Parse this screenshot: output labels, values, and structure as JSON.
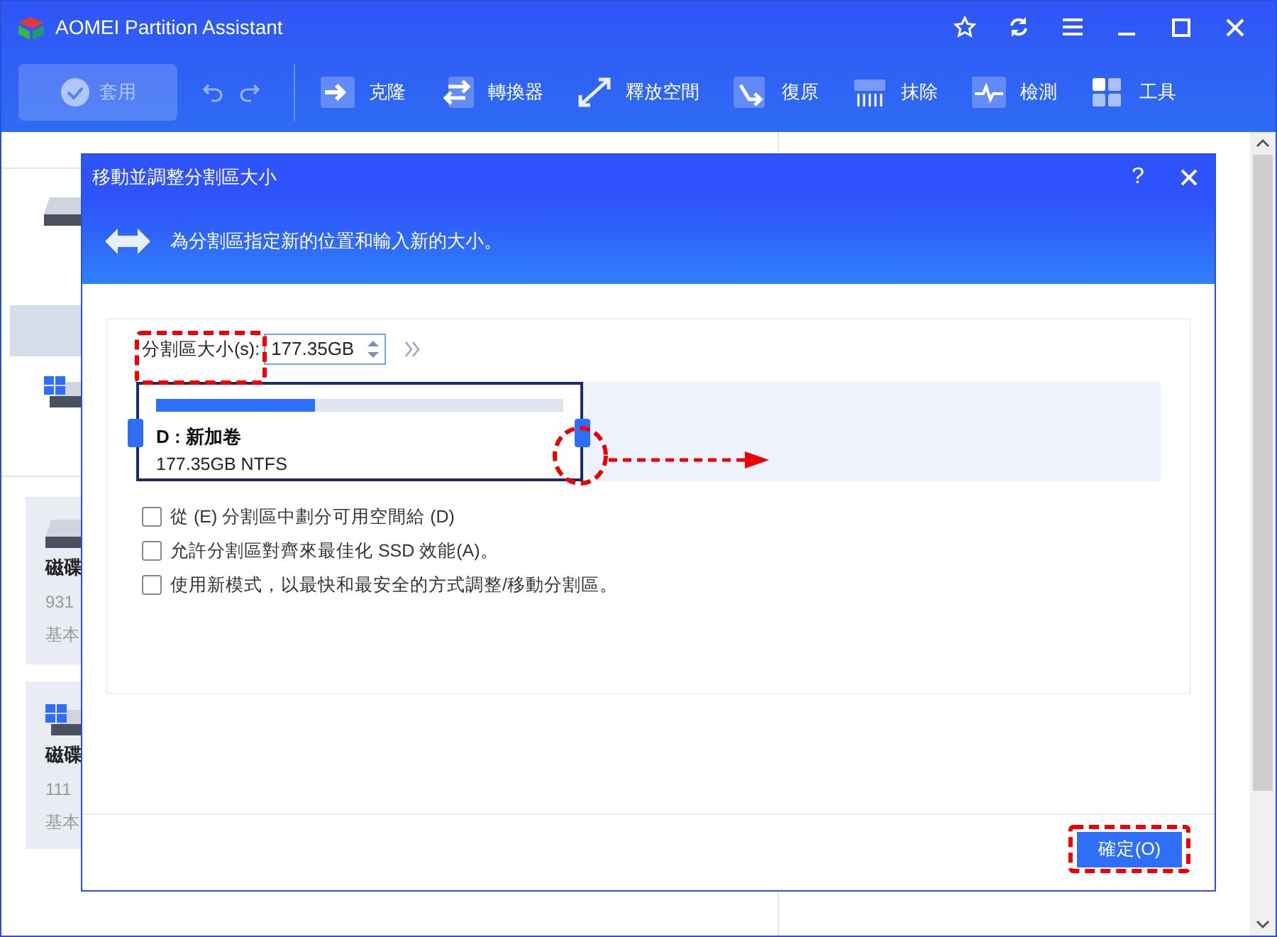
{
  "app": {
    "title": "AOMEI Partition Assistant"
  },
  "toolbar": {
    "apply": {
      "label": "套用",
      "disabled": true
    },
    "items": [
      {
        "kind": "clone",
        "label": "克隆"
      },
      {
        "kind": "convert",
        "label": "轉換器"
      },
      {
        "kind": "free",
        "label": "釋放空間"
      },
      {
        "kind": "recover",
        "label": "復原"
      },
      {
        "kind": "wipe",
        "label": "抹除"
      },
      {
        "kind": "test",
        "label": "檢測"
      },
      {
        "kind": "tools",
        "label": "工具"
      }
    ]
  },
  "disks": [
    {
      "kind": "data",
      "name": "磁碟",
      "size": "931",
      "type": "基本"
    },
    {
      "kind": "system",
      "name": "磁碟",
      "size": "111",
      "type": "基本"
    }
  ],
  "dialog": {
    "title": "移動並調整分割區大小",
    "help": "?",
    "header": "為分割區指定新的位置和輸入新的大小。",
    "size_label": "分割區大小(s):",
    "size_value": "177.35GB",
    "partition": {
      "name": "D : 新加卷",
      "detail": "177.35GB NTFS",
      "level": 0.39
    },
    "options": [
      {
        "label": "從 (E) 分割區中劃分可用空間給 (D)",
        "checked": false
      },
      {
        "label": "允許分割區對齊來最佳化 SSD 效能(A)。",
        "checked": false
      },
      {
        "label": "使用新模式，以最快和最安全的方式調整/移動分割區。",
        "checked": false
      }
    ],
    "ok_button": "確定(O)"
  }
}
